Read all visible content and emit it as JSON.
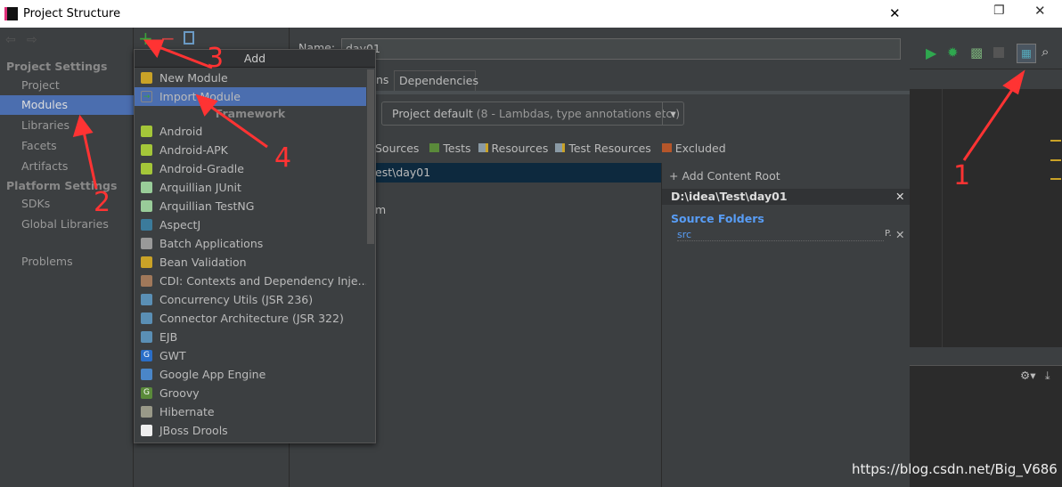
{
  "window": {
    "title": "Project Structure",
    "close": "✕"
  },
  "sidebar": {
    "project_settings": "Project Settings",
    "platform_settings": "Platform Settings",
    "items": [
      {
        "label": "Project"
      },
      {
        "label": "Modules",
        "selected": true
      },
      {
        "label": "Libraries"
      },
      {
        "label": "Facets"
      },
      {
        "label": "Artifacts"
      }
    ],
    "platform_items": [
      {
        "label": "SDKs"
      },
      {
        "label": "Global Libraries"
      }
    ],
    "problems": "Problems"
  },
  "toolbar": {
    "add": "+",
    "remove": "−"
  },
  "main": {
    "name_label": "Name:",
    "name_value": "day01",
    "tab_partial": "ns",
    "tab_dependencies": "Dependencies",
    "language_level": "Project default",
    "language_level_hint": "(8 - Lambdas, type annotations etc.)",
    "markers": [
      "Sources",
      "Tests",
      "Resources",
      "Test Resources",
      "Excluded"
    ],
    "tree_path": "est\\day01",
    "tree_item2": "m",
    "add_content_root": "+ Add Content Root",
    "content_root": "D:\\idea\\Test\\day01",
    "source_folders": "Source Folders",
    "src": "src",
    "src_actions": "P."
  },
  "popup": {
    "title": "Add",
    "section": "Framework",
    "top_items": [
      {
        "label": "New Module",
        "icon": "folder-module-icon"
      },
      {
        "label": "Import Module",
        "icon": "import-icon",
        "selected": true
      }
    ],
    "items": [
      {
        "label": "Android",
        "icon": "android-folder-icon",
        "color": "#a4c639"
      },
      {
        "label": "Android-APK",
        "icon": "android-icon",
        "color": "#a4c639"
      },
      {
        "label": "Android-Gradle",
        "icon": "android-icon",
        "color": "#a4c639"
      },
      {
        "label": "Arquillian JUnit",
        "icon": "alien-icon",
        "color": "#9c9"
      },
      {
        "label": "Arquillian TestNG",
        "icon": "alien-icon",
        "color": "#9c9"
      },
      {
        "label": "AspectJ",
        "icon": "aspectj-icon",
        "color": "#3b7b9b"
      },
      {
        "label": "Batch Applications",
        "icon": "batch-icon",
        "color": "#999"
      },
      {
        "label": "Bean Validation",
        "icon": "bean-icon",
        "color": "#c9a227"
      },
      {
        "label": "CDI: Contexts and Dependency Inje...",
        "icon": "cdi-icon",
        "color": "#a0785a"
      },
      {
        "label": "Concurrency Utils (JSR 236)",
        "icon": "jee-icon",
        "color": "#5a8fb5"
      },
      {
        "label": "Connector Architecture (JSR 322)",
        "icon": "jee-icon",
        "color": "#5a8fb5"
      },
      {
        "label": "EJB",
        "icon": "ejb-icon",
        "color": "#5a8fb5"
      },
      {
        "label": "GWT",
        "icon": "gwt-icon",
        "color": "#2a6ec8",
        "glyph": "G"
      },
      {
        "label": "Google App Engine",
        "icon": "app-engine-icon",
        "color": "#4a86c8"
      },
      {
        "label": "Groovy",
        "icon": "groovy-icon",
        "color": "#5a8a3a",
        "glyph": "G"
      },
      {
        "label": "Hibernate",
        "icon": "hibernate-icon",
        "color": "#998"
      },
      {
        "label": "JBoss Drools",
        "icon": "drools-icon",
        "color": "#eee"
      }
    ]
  },
  "annotations": [
    "1",
    "2",
    "3",
    "4"
  ],
  "watermark": "https://blog.csdn.net/Big_V686",
  "colors": {
    "selection": "#4b6eaf",
    "annotation": "#ff3333",
    "link": "#589df6"
  }
}
